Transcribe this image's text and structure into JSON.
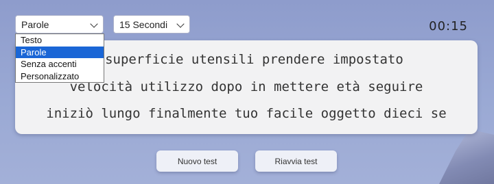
{
  "controls": {
    "mode_select": {
      "value": "Parole",
      "options": [
        "Testo",
        "Parole",
        "Senza accenti",
        "Personalizzato"
      ],
      "selected_index": 1
    },
    "time_select": {
      "value": "15 Secondi"
    }
  },
  "timer": "00:15",
  "text_lines": [
    "o superficie utensili prendere impostato",
    "velocità utilizzo dopo in mettere età seguire",
    "iniziò lungo finalmente tuo facile oggetto dieci se"
  ],
  "buttons": {
    "new_test": "Nuovo test",
    "restart_test": "Riavvia test"
  },
  "colors": {
    "highlight": "#1a66d6",
    "background": "#9aa9d4"
  }
}
